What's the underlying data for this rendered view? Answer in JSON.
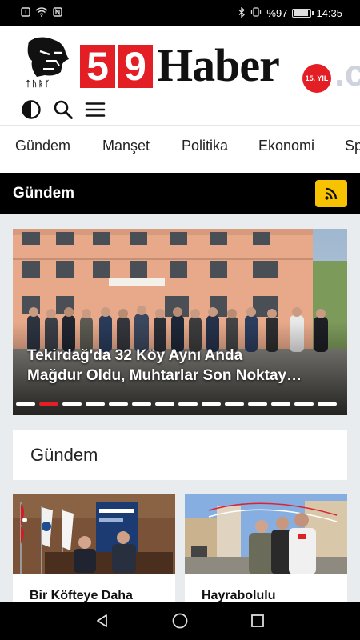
{
  "status": {
    "battery": "%97",
    "time": "14:35",
    "battery_level": 0.97
  },
  "logo": {
    "num1": "5",
    "num2": "9",
    "word": "Haber",
    "badge": "15. YIL",
    "tld": ".co",
    "sub": "ᛏᚢᚱᚴ"
  },
  "nav": {
    "items": [
      "Gündem",
      "Manşet",
      "Politika",
      "Ekonomi",
      "Sp"
    ]
  },
  "section": {
    "title": "Gündem"
  },
  "slider": {
    "caption_line1": "Tekirdağ'da 32 Köy Aynı Anda",
    "caption_line2": "Mağdur Oldu, Muhtarlar Son Noktay…",
    "dots": 14,
    "active_index": 1
  },
  "gundem_card": {
    "title": "Gündem"
  },
  "news": [
    {
      "title": "Bir Köfteye Daha"
    },
    {
      "title": "Hayrabolulu"
    }
  ],
  "colors": {
    "brand_red": "#e31e24",
    "rss_yellow": "#f7c300",
    "dark": "#000000"
  }
}
